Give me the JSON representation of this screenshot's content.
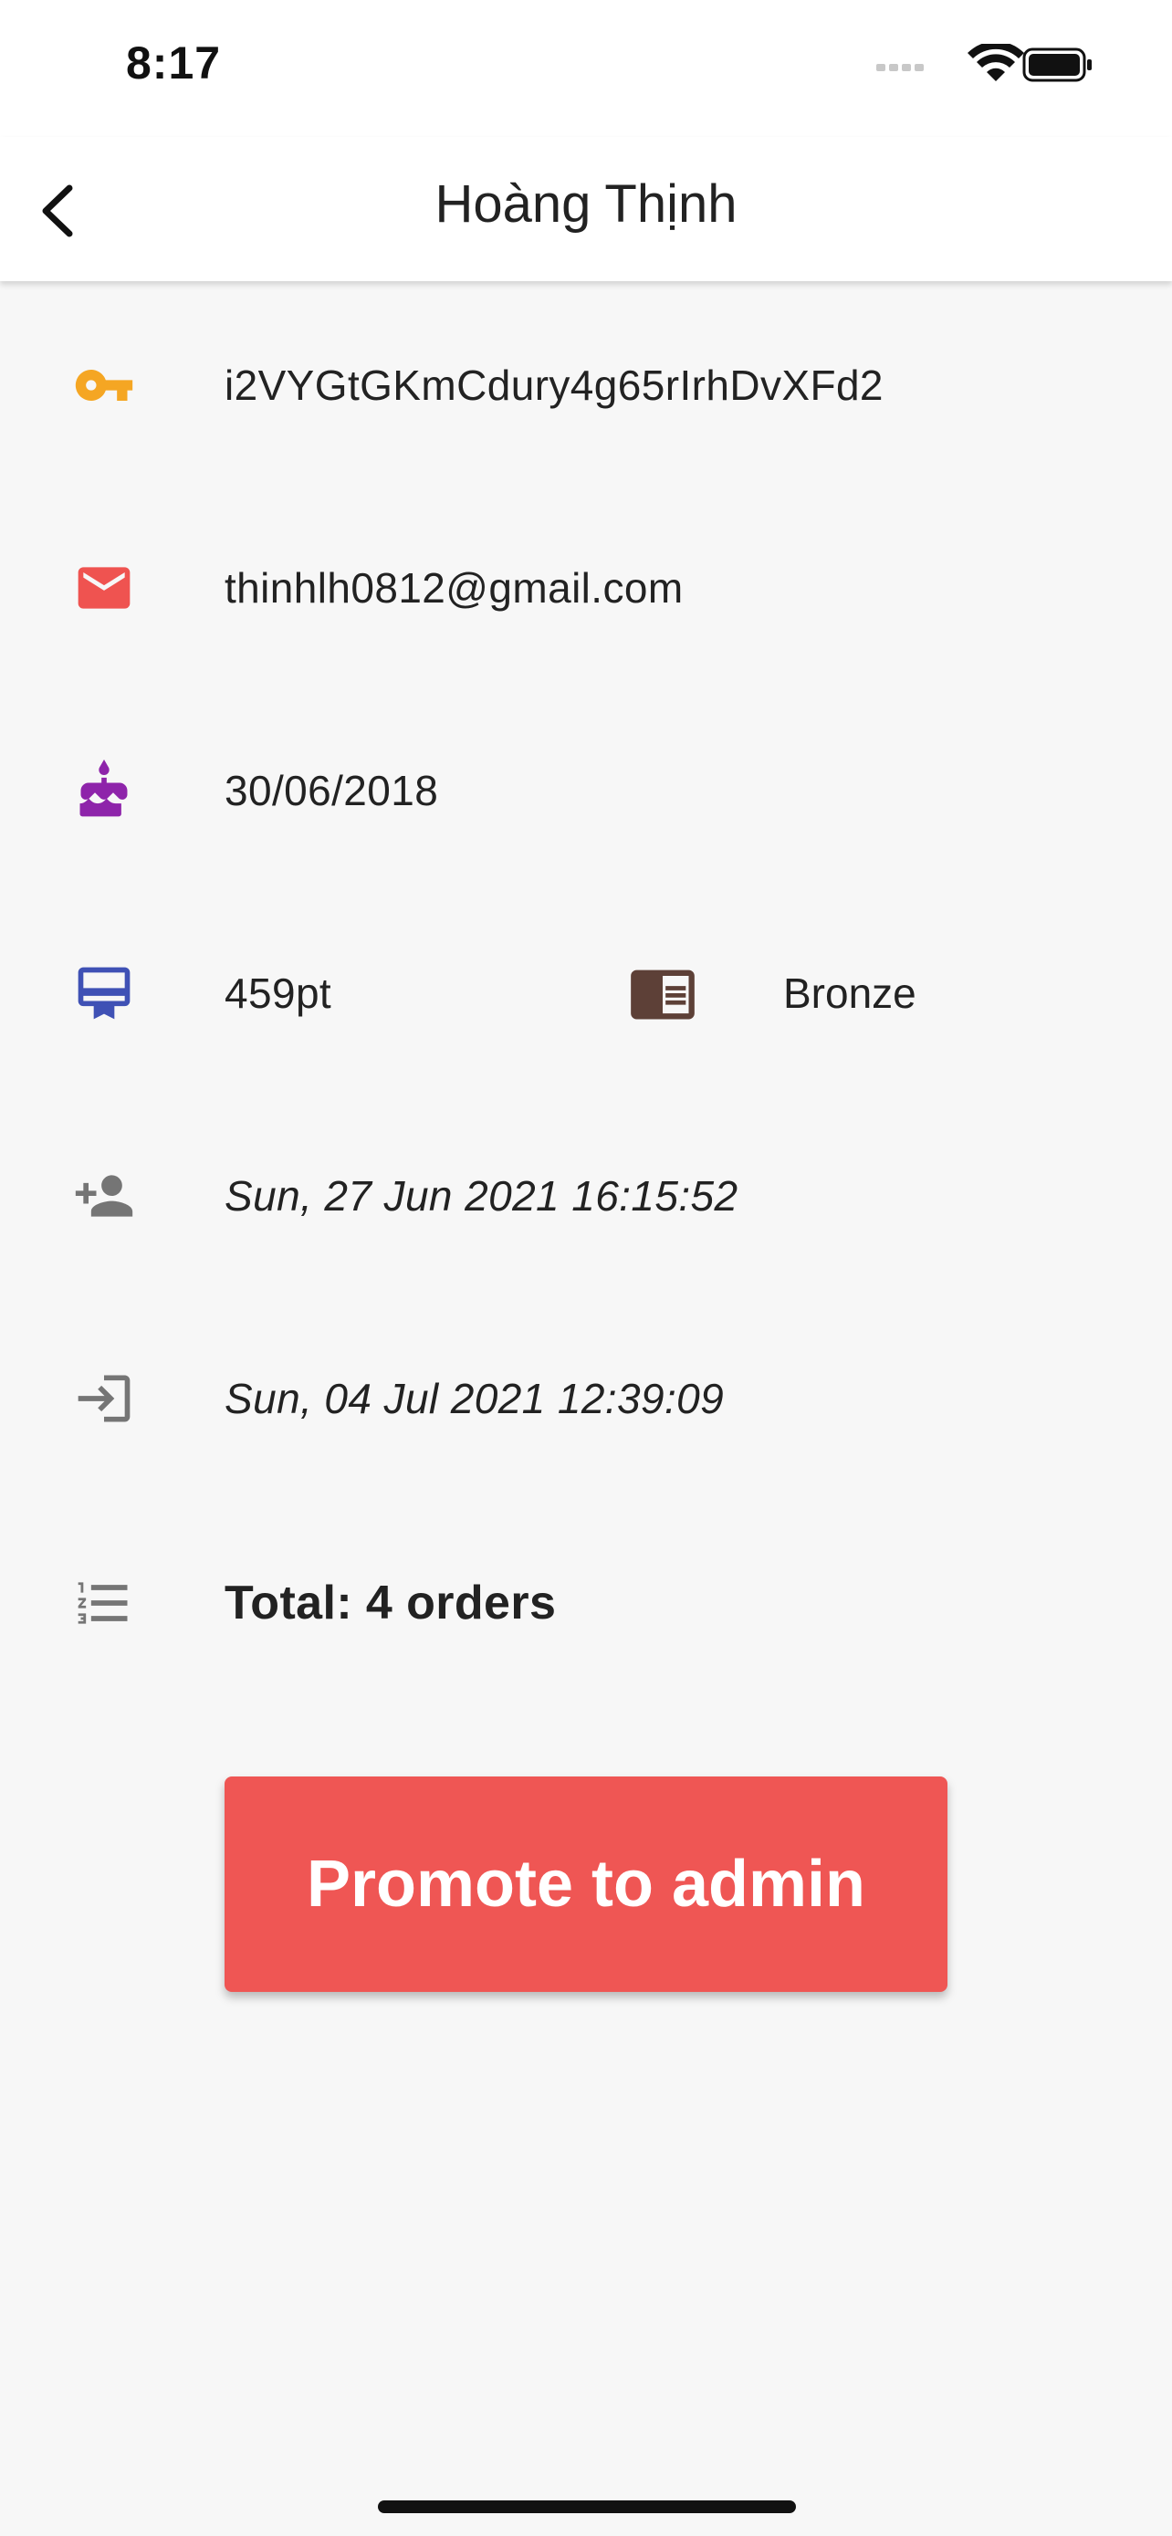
{
  "status_bar": {
    "time": "8:17"
  },
  "app_bar": {
    "title": "Hoàng Thịnh"
  },
  "details": {
    "uid": "i2VYGtGKmCdury4g65rIrhDvXFd2",
    "email": "thinhlh0812@gmail.com",
    "birthday": "30/06/2018",
    "points": "459pt",
    "tier": "Bronze",
    "created_at": "Sun, 27 Jun 2021 16:15:52",
    "last_login": "Sun, 04 Jul 2021 12:39:09",
    "orders_total": "Total: 4 orders"
  },
  "actions": {
    "promote_label": "Promote to admin"
  },
  "colors": {
    "key_icon": "#f5a623",
    "mail_icon": "#ef5350",
    "cake_icon": "#8e24aa",
    "card_icon": "#3f51b5",
    "tier_icon": "#5d4037",
    "grey_icon": "#757575",
    "promote_button": "#ef5654"
  },
  "icons": [
    "back-icon",
    "key-icon",
    "email-icon",
    "cake-icon",
    "loyalty-card-icon",
    "tier-book-icon",
    "person-add-icon",
    "login-icon",
    "order-list-icon",
    "wifi-icon",
    "battery-icon",
    "signal-icon"
  ]
}
